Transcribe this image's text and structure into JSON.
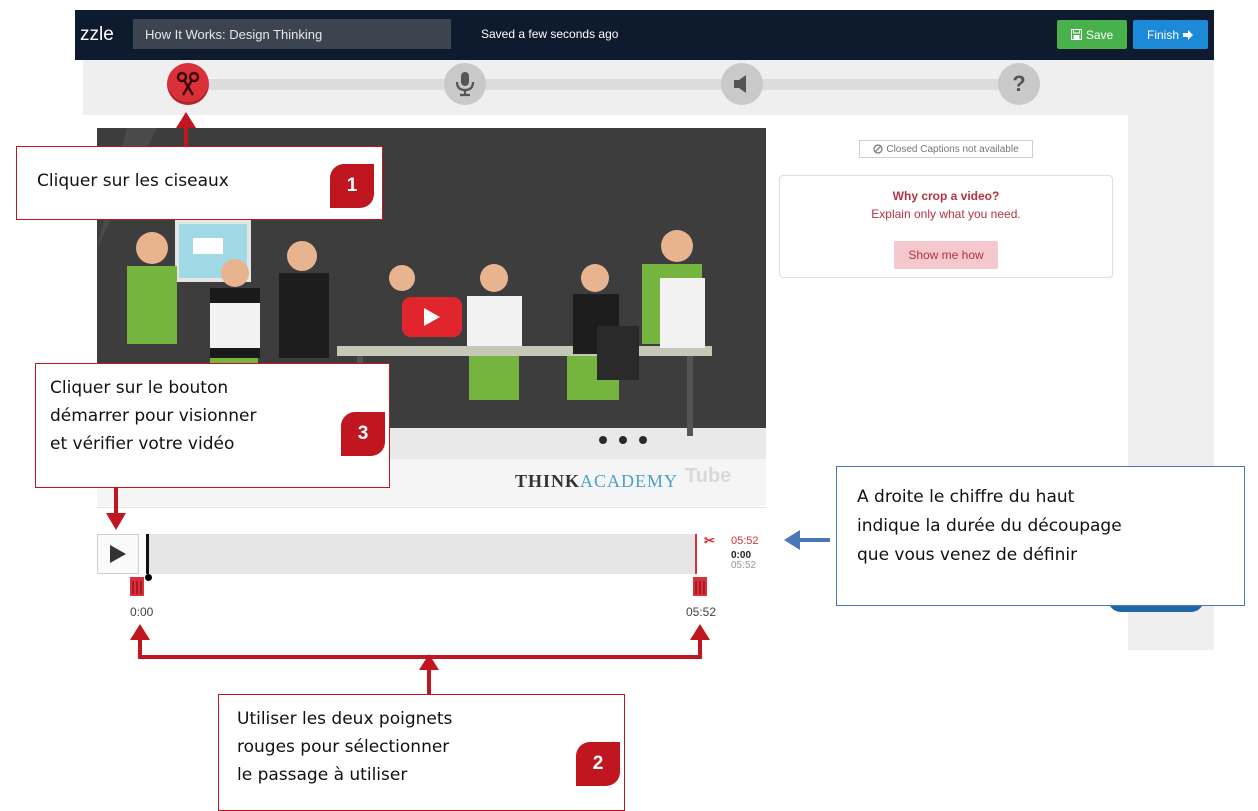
{
  "header": {
    "brand": "zzle",
    "video_title": "How It Works: Design Thinking",
    "saved_status": "Saved a few seconds ago",
    "save_label": "Save",
    "finish_label": "Finish"
  },
  "steps": [
    {
      "name": "crop",
      "icon": "scissors-icon",
      "active": true
    },
    {
      "name": "voice",
      "icon": "microphone-icon",
      "active": false
    },
    {
      "name": "sound",
      "icon": "speaker-icon",
      "active": false
    },
    {
      "name": "help",
      "icon": "question-icon",
      "label": "?",
      "active": false
    }
  ],
  "video": {
    "brand_text_1": "THINK",
    "brand_text_2": "ACADEMY",
    "watermark": "Tube"
  },
  "side_panel": {
    "cc_badge": "Closed Captions not available",
    "crop_heading": "Why crop a video?",
    "crop_sub": "Explain only what you need.",
    "show_me": "Show me how"
  },
  "timeline": {
    "crop_duration": "05:52",
    "current_time": "0:00",
    "total_time": "05:52",
    "start_label": "0:00",
    "end_label": "05:52"
  },
  "annotations": {
    "c1_text": "Cliquer sur les ciseaux",
    "c1_badge": "1",
    "c3_line1": "Cliquer sur le bouton",
    "c3_line2": "démarrer pour visionner",
    "c3_line3": "et vérifier votre vidéo",
    "c3_badge": "3",
    "c2_line1": "Utiliser les deux poignets",
    "c2_line2": "rouges pour sélectionner",
    "c2_line3": "le passage à utiliser",
    "c2_badge": "2",
    "blue_line1": "A droite le chiffre du haut",
    "blue_line2": "indique la durée du découpage",
    "blue_line3": "que vous venez de définir"
  },
  "colors": {
    "topbar": "#0e1a2e",
    "save": "#48b14b",
    "finish": "#1c8ad6",
    "accent_red": "#c0161f",
    "arrow_blue": "#4a77b5"
  }
}
